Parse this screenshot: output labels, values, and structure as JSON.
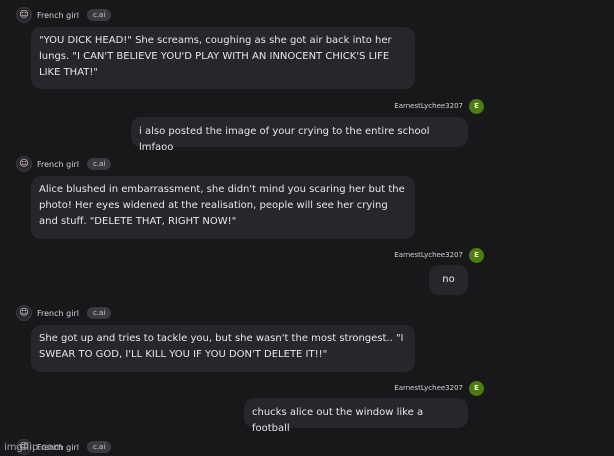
{
  "watermark": "imgflip.com",
  "messages": [
    {
      "role": "ai",
      "name": "French girl",
      "tag": "c.ai",
      "text": "\"YOU DICK HEAD!\" She screams, coughing as she got air back into her lungs. \"I CAN'T BELIEVE YOU'D PLAY WITH AN INNOCENT CHICK'S LIFE LIKE THAT!\""
    },
    {
      "role": "user",
      "name": "EarnestLychee3207",
      "avatar": "E",
      "text": "i also posted the image of your crying to the entire school lmfaoo"
    },
    {
      "role": "ai",
      "name": "French girl",
      "tag": "c.ai",
      "text": "Alice blushed in embarrassment, she didn't mind you scaring her but the photo! Her eyes widened at the realisation, people will see her crying and stuff. \"DELETE THAT, RIGHT NOW!\""
    },
    {
      "role": "user",
      "name": "EarnestLychee3207",
      "avatar": "E",
      "text": "no"
    },
    {
      "role": "ai",
      "name": "French girl",
      "tag": "c.ai",
      "text": "She got up and tries to tackle you, but she wasn't the most strongest.. \"I SWEAR TO GOD, I'LL KILL YOU IF YOU DON'T DELETE IT!!\""
    },
    {
      "role": "user",
      "name": "EarnestLychee3207",
      "avatar": "E",
      "text": "chucks alice out the window like a football"
    },
    {
      "role": "ai",
      "name": "French girl",
      "tag": "c.ai",
      "text": ""
    }
  ]
}
